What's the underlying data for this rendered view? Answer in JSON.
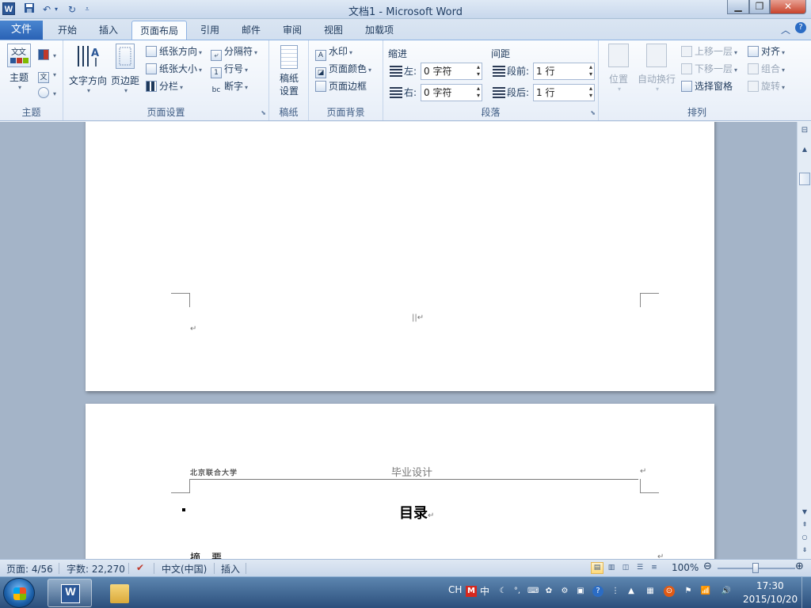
{
  "window": {
    "app_icon": "W",
    "title": "文档1  -  Microsoft Word",
    "minimize_icon": "minimize-icon",
    "maximize_icon": "maximize-icon",
    "close_icon": "close-icon"
  },
  "qat": {
    "save_icon": "save-icon",
    "undo_icon": "undo-icon",
    "redo_icon": "redo-icon",
    "customize_icon": "chevron-down-icon"
  },
  "tabs": {
    "file": "文件",
    "items": [
      "开始",
      "插入",
      "页面布局",
      "引用",
      "邮件",
      "审阅",
      "视图",
      "加载项"
    ],
    "active": "页面布局"
  },
  "ribbon": {
    "theme": {
      "group_label": "主题",
      "themes_button": "主题"
    },
    "page_setup": {
      "group_label": "页面设置",
      "text_direction": "文字方向",
      "margins": "页边距",
      "orientation": "纸张方向",
      "size": "纸张大小",
      "columns": "分栏",
      "breaks": "分隔符",
      "line_numbers": "行号",
      "hyphenation": "断字"
    },
    "manuscript": {
      "group_label": "稿纸",
      "settings": "稿纸\n设置"
    },
    "page_background": {
      "group_label": "页面背景",
      "watermark": "水印",
      "page_color": "页面颜色",
      "page_borders": "页面边框"
    },
    "paragraph": {
      "group_label": "段落",
      "indent_label": "缩进",
      "indent_left_label": "左:",
      "indent_left_value": "0 字符",
      "indent_right_label": "右:",
      "indent_right_value": "0 字符",
      "spacing_label": "间距",
      "spacing_before_label": "段前:",
      "spacing_before_value": "1 行",
      "spacing_after_label": "段后:",
      "spacing_after_value": "1 行"
    },
    "arrange": {
      "group_label": "排列",
      "position": "位置",
      "wrap_text": "自动换行",
      "bring_forward": "上移一层",
      "send_backward": "下移一层",
      "selection_pane": "选择窗格",
      "align": "对齐",
      "group": "组合",
      "rotate": "旋转"
    }
  },
  "document": {
    "page_break_mark": "||↵",
    "paragraph_mark": "↵",
    "header_left": "北京联合大学",
    "header_center": "毕业设计",
    "toc_title": "目录",
    "toc_first_entry": "摘要"
  },
  "statusbar": {
    "page": "页面: 4/56",
    "words": "字数: 22,270",
    "language": "中文(中国)",
    "mode": "插入",
    "zoom": "100%",
    "zoom_level_percent": 100
  },
  "taskbar": {
    "ime_lang": "CH",
    "ime_mode": "中",
    "clock_time": "17:30",
    "clock_date": "2015/10/20"
  }
}
